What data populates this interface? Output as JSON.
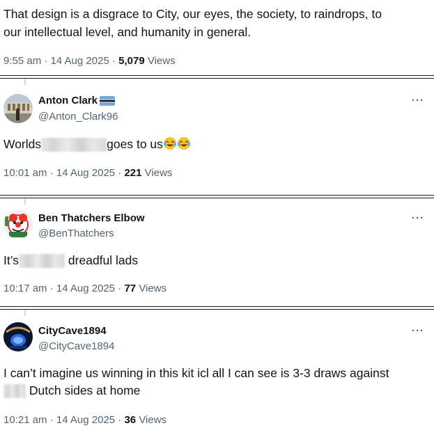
{
  "tweets": [
    {
      "text": "That design is a disgrace to City, our eyes, the society, to raindrops, to",
      "text_line2": "our intellectual level, and humanity in general.",
      "time": "9:55 am · 14 Aug 2025 · ",
      "views_count": "5,079",
      "views_label": "Views"
    },
    {
      "display_name": "Anton Clark",
      "handle": "@Anton_Clark96",
      "more": "···",
      "text_before": "Worlds",
      "text_after": "goes to us",
      "time": "10:01 am · 14 Aug 2025 · ",
      "views_count": "221",
      "views_label": "Views"
    },
    {
      "display_name": "Ben Thatchers Elbow",
      "handle": "@BenThatchers",
      "more": "···",
      "text_before": "It’s",
      "text_after": "dreadful lads",
      "time": "10:17 am · 14 Aug 2025 · ",
      "views_count": "77",
      "views_label": "Views"
    },
    {
      "display_name": "CityCave1894",
      "handle": "@CityCave1894",
      "more": "···",
      "text_line1": "I can’t imagine us winning in this kit icl all I can see is 3-3 draws against",
      "text_line2_after": "Dutch sides at home",
      "time": "10:21 am · 14 Aug 2025 · ",
      "views_count": "36",
      "views_label": "Views"
    }
  ],
  "icons": {
    "flag": "botswana-flag-icon",
    "emoji": "tears-of-joy-emoji-icon",
    "avatar_placeholder": "user-avatar-icon"
  },
  "colors": {
    "text_primary": "#0f1419",
    "text_secondary": "#536471",
    "separator": "#1a1a1a"
  }
}
